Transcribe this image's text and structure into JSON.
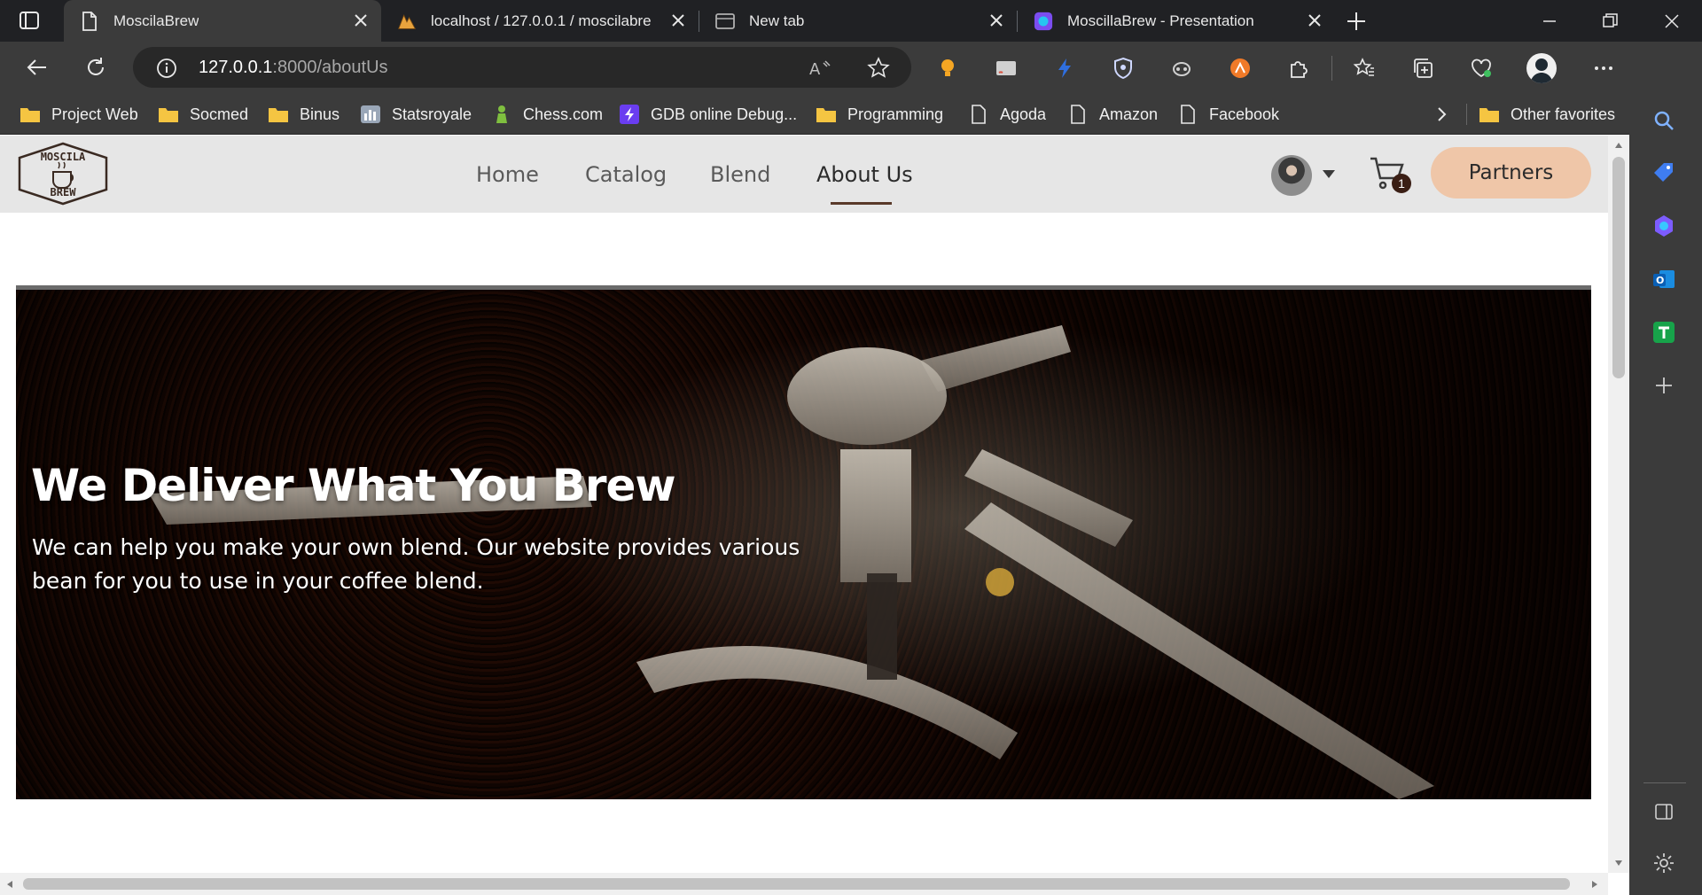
{
  "browser": {
    "tabs": [
      {
        "title": "MoscilaBrew",
        "active": true
      },
      {
        "title": "localhost / 127.0.0.1 / moscilabre",
        "active": false
      },
      {
        "title": "New tab",
        "active": false
      },
      {
        "title": "MoscillaBrew - Presentation",
        "active": false
      }
    ],
    "address": {
      "host": "127.0.0.1",
      "path": ":8000/aboutUs"
    },
    "bookmarks": [
      {
        "label": "Project Web",
        "icon": "folder-icon"
      },
      {
        "label": "Socmed",
        "icon": "folder-icon"
      },
      {
        "label": "Binus",
        "icon": "folder-icon"
      },
      {
        "label": "Statsroyale",
        "icon": "statsroyale-icon"
      },
      {
        "label": "Chess.com",
        "icon": "chess-icon"
      },
      {
        "label": "GDB online Debug...",
        "icon": "gdb-icon"
      },
      {
        "label": "Programming",
        "icon": "folder-icon"
      },
      {
        "label": "Agoda",
        "icon": "page-icon"
      },
      {
        "label": "Amazon",
        "icon": "page-icon"
      },
      {
        "label": "Facebook",
        "icon": "page-icon"
      }
    ],
    "other_favorites": "Other favorites"
  },
  "site": {
    "logo": {
      "line1": "MOSCILA",
      "line2": "BREW"
    },
    "nav": [
      {
        "label": "Home",
        "active": false
      },
      {
        "label": "Catalog",
        "active": false
      },
      {
        "label": "Blend",
        "active": false
      },
      {
        "label": "About Us",
        "active": true
      }
    ],
    "cart_count": "1",
    "partners_label": "Partners",
    "hero": {
      "title": "We Deliver What You Brew",
      "text": "We can help you make your own blend. Our website provides various bean for you to use in your coffee blend."
    }
  },
  "colors": {
    "accent": "#efc6a8",
    "nav_underline": "#5a3a2a",
    "browser_dark": "#202124"
  }
}
